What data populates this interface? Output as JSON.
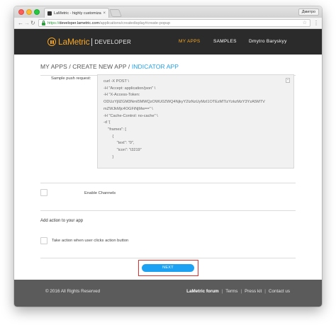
{
  "browser": {
    "tab_title": "LaMetric - highly customizable",
    "tab_close": "×",
    "profile_name": "Дмитро",
    "url_scheme": "https://",
    "url_host": "developer.lametric.com",
    "url_path": "/applications/createdisplay#create-popup",
    "icons": {
      "back": "arrow-left-icon",
      "forward": "arrow-right-icon",
      "reload": "reload-icon",
      "star": "star-icon",
      "menu": "kebab-menu-icon"
    }
  },
  "header": {
    "brand": "LaMetric",
    "sub": "DEVELOPER",
    "nav": {
      "my_apps": "MY APPS",
      "samples": "SAMPLES",
      "user": "Dmytro Baryskyy"
    },
    "accent_color": "#f5a623"
  },
  "breadcrumb": {
    "part1": "MY APPS",
    "sep1": " / ",
    "part2": "CREATE NEW APP",
    "sep2": " / ",
    "current": "INDICATOR APP"
  },
  "form": {
    "sample_push_label": "Sample push request:",
    "code_lines": [
      "curl -X POST \\",
      "-H \"Accept: application/json\" \\",
      "-H \"X-Access-Token:",
      "ODUzYjllZGM3NmI5MWQzOWU0ZWQ4NjkyY2IzNzUyMzI1OTEzMTIzYzkzMzY3YzA5MTV",
      "mZWJkMjc4OGFiNjMw==\" \\",
      "-H \"Cache-Control: no-cache\" \\",
      "-d '{",
      "    \"frames\": [",
      "        {",
      "            \"text\": \"0\",",
      "            \"icon\": \"i3219\"",
      "        }"
    ],
    "enable_channels_label": "Enable Channels",
    "add_action_heading": "Add action to your app",
    "take_action_label": "Take action when user clicks action button",
    "next_label": "NEXT"
  },
  "footer": {
    "copyright": "© 2016 All Rights Reserved",
    "links": {
      "forum": "LaMetric forum",
      "terms": "Terms",
      "press": "Press kit",
      "contact": "Contact us"
    },
    "sep": "|"
  }
}
